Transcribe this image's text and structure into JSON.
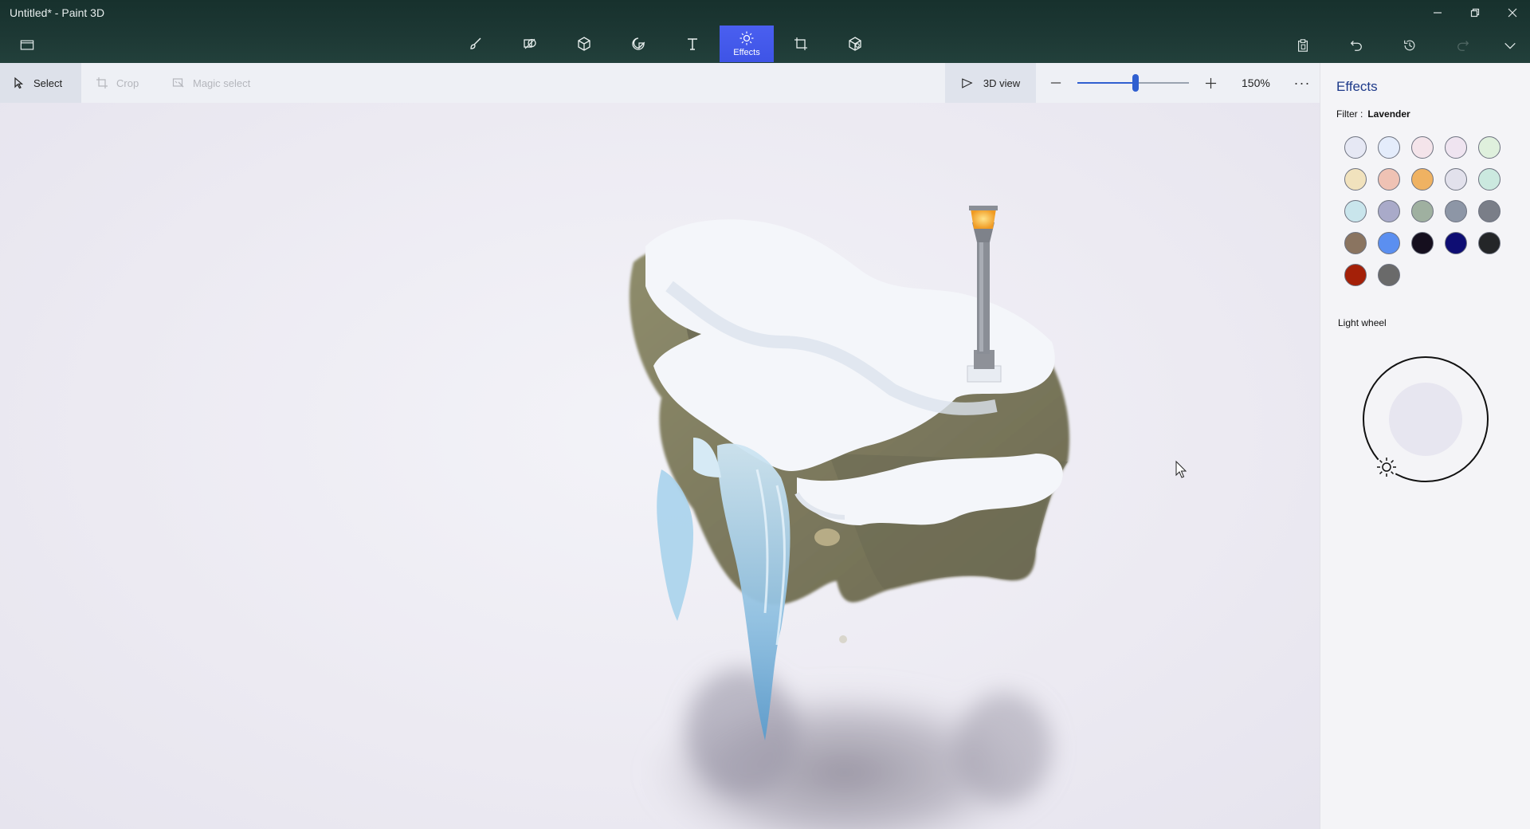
{
  "window": {
    "title": "Untitled* - Paint 3D",
    "controls": [
      "minimize-icon",
      "restore-icon",
      "close-icon"
    ]
  },
  "toolbar": {
    "menu_icon": "folder-icon",
    "tools": [
      {
        "id": "brushes",
        "icon": "brush-icon",
        "label": ""
      },
      {
        "id": "2d-shapes",
        "icon": "2d-shapes-icon",
        "label": ""
      },
      {
        "id": "3d-shapes",
        "icon": "cube-icon",
        "label": ""
      },
      {
        "id": "stickers",
        "icon": "sticker-icon",
        "label": ""
      },
      {
        "id": "text",
        "icon": "text-icon",
        "label": ""
      },
      {
        "id": "effects",
        "icon": "sun-icon",
        "label": "Effects",
        "active": true
      },
      {
        "id": "canvas",
        "icon": "canvas-crop-icon",
        "label": ""
      },
      {
        "id": "3d-library",
        "icon": "3d-library-icon",
        "label": ""
      }
    ],
    "right_tools": [
      "paste-icon",
      "undo-icon",
      "history-icon",
      "redo-icon",
      "chevron-down-icon"
    ]
  },
  "subbar": {
    "select_label": "Select",
    "crop_label": "Crop",
    "magic_select_label": "Magic select",
    "view3d_label": "3D view",
    "zoom_value": "150%",
    "zoom_fraction": 0.52,
    "more_label": "···"
  },
  "panel": {
    "title": "Effects",
    "filter_label": "Filter :",
    "filter_value": "Lavender",
    "swatches": [
      "#e6e8f4",
      "#e4ecfb",
      "#f4e4ea",
      "#efe4f0",
      "#dff0dd",
      "#f1e2bd",
      "#efc2b4",
      "#efb262",
      "#e2e1ec",
      "#cbe9df",
      "#c9e5ec",
      "#a9aac9",
      "#9fb0a0",
      "#8d96a6",
      "#7a7e88",
      "#8a7460",
      "#5b8ff0",
      "#150f1e",
      "#0e0d73",
      "#242628",
      "#a42008",
      "#6a6a6a"
    ],
    "light_wheel_label": "Light wheel",
    "light_icon": "sun-icon"
  }
}
